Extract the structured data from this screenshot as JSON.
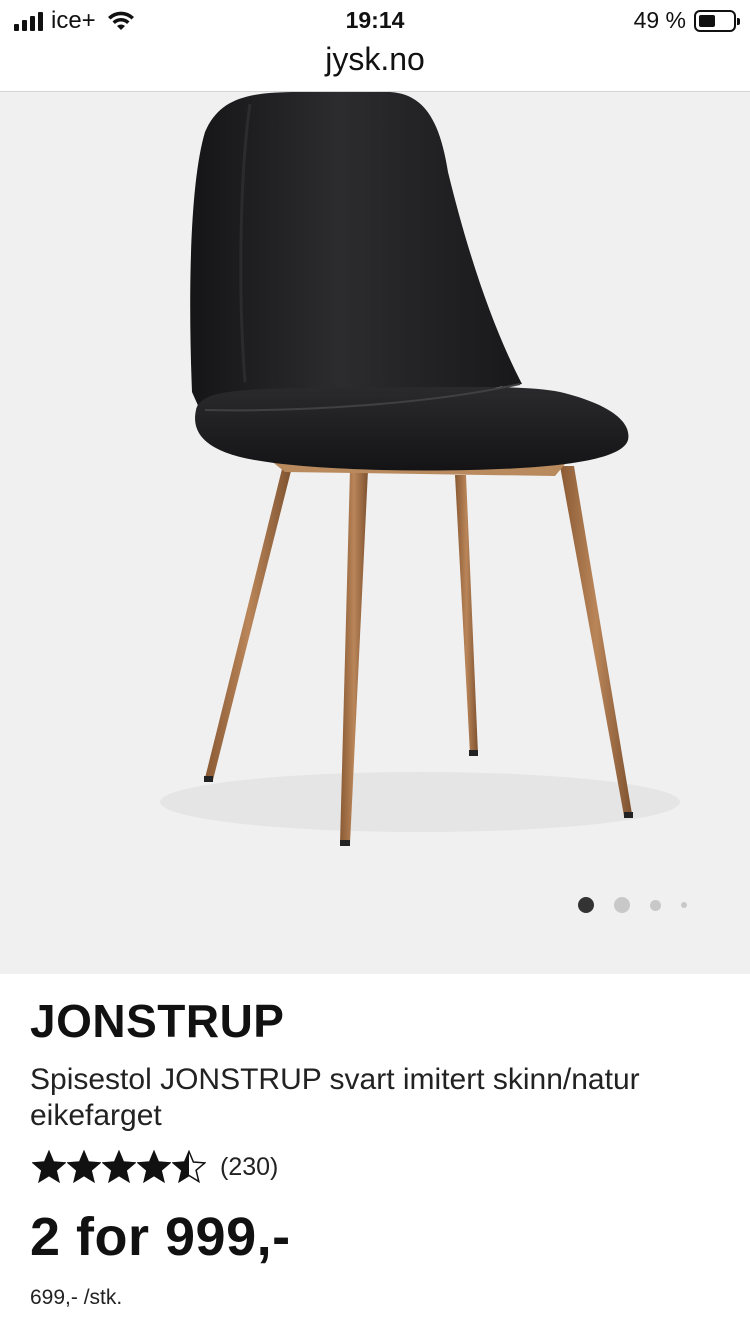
{
  "status_bar": {
    "carrier": "ice+",
    "time": "19:14",
    "battery_percent": "49 %",
    "battery_level": 0.49,
    "signal_icon": "signal-bars-icon",
    "wifi_icon": "wifi-icon",
    "battery_icon": "battery-icon"
  },
  "browser": {
    "url": "jysk.no"
  },
  "gallery": {
    "image_subject": "chair",
    "active_index": 0,
    "dot_count": 4
  },
  "product": {
    "name": "JONSTRUP",
    "description": "Spisestol JONSTRUP svart imitert skinn/natur eikefarget",
    "rating": 4.5,
    "rating_max": 5,
    "review_count": "(230)",
    "price": "2 for 999,-",
    "unit_price": "699,- /stk."
  },
  "colors": {
    "text": "#111111",
    "image_background": "#f1f0f0",
    "seat": "#1d1d1f",
    "wood": "#a8744a"
  }
}
